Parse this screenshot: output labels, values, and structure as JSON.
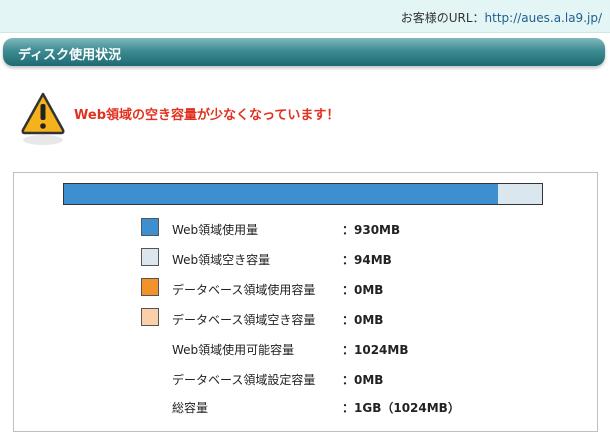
{
  "url_bar": {
    "label": "お客様のURL：",
    "link": "http://aues.a.la9.jp/"
  },
  "section": {
    "title": "ディスク使用状況"
  },
  "warning": {
    "icon": "warning-icon",
    "message": "Web領域の空き容量が少なくなっています！"
  },
  "usage": {
    "used_fraction": 0.908,
    "colors": {
      "fill": "#3d8fcf",
      "background": "#dbe7ee"
    }
  },
  "legend": [
    {
      "label": "Web領域使用量",
      "value": "：930MB",
      "swatch": "#3d8fcf"
    },
    {
      "label": "Web領域空き容量",
      "value": "：94MB",
      "swatch": "#dbe7ee"
    },
    {
      "label": "データベース領域使用容量",
      "value": "：0MB",
      "swatch": "#f2922a"
    },
    {
      "label": "データベース領域空き容量",
      "value": "：0MB",
      "swatch": "#fbd0a8"
    },
    {
      "label": "Web領域使用可能容量",
      "value": "：1024MB",
      "swatch": null
    },
    {
      "label": "データベース領域設定容量",
      "value": "：0MB",
      "swatch": null
    },
    {
      "label": "総容量",
      "value": "：1GB（1024MB）",
      "swatch": null
    }
  ]
}
